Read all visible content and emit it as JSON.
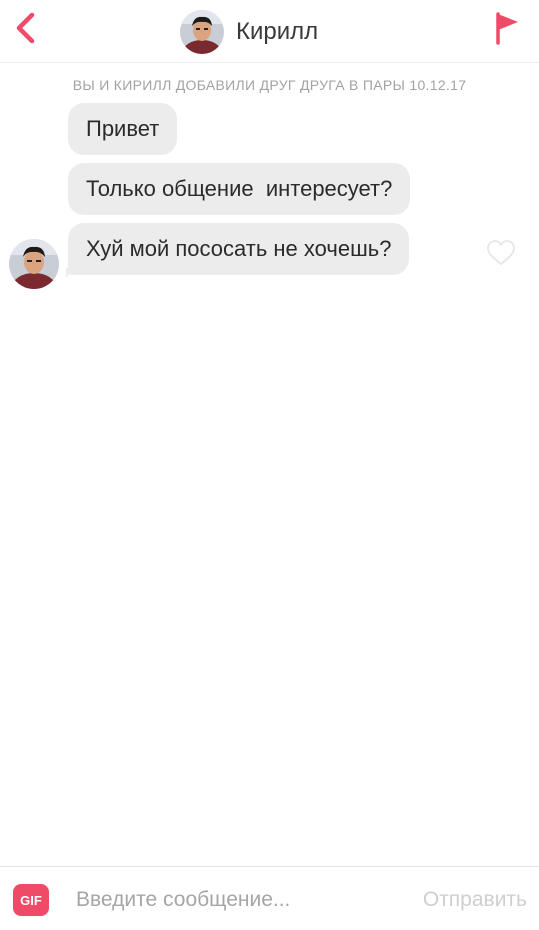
{
  "header": {
    "contact_name": "Кирилл",
    "back_icon": "chevron-left-icon",
    "flag_icon": "flag-icon",
    "accent_color": "#ef4a68"
  },
  "chat": {
    "match_notice": "ВЫ И КИРИЛЛ ДОБАВИЛИ ДРУГ ДРУГА В ПАРЫ 10.12.17",
    "messages": [
      {
        "sender": "Кирилл",
        "text": "Привет"
      },
      {
        "sender": "Кирилл",
        "text": "Только общение  интересует?"
      },
      {
        "sender": "Кирилл",
        "text": "Хуй мой пососать не хочешь?"
      }
    ],
    "like_icon": "heart-outline-icon"
  },
  "composer": {
    "gif_label": "GIF",
    "input_placeholder": "Введите сообщение...",
    "input_value": "",
    "send_label": "Отправить"
  }
}
